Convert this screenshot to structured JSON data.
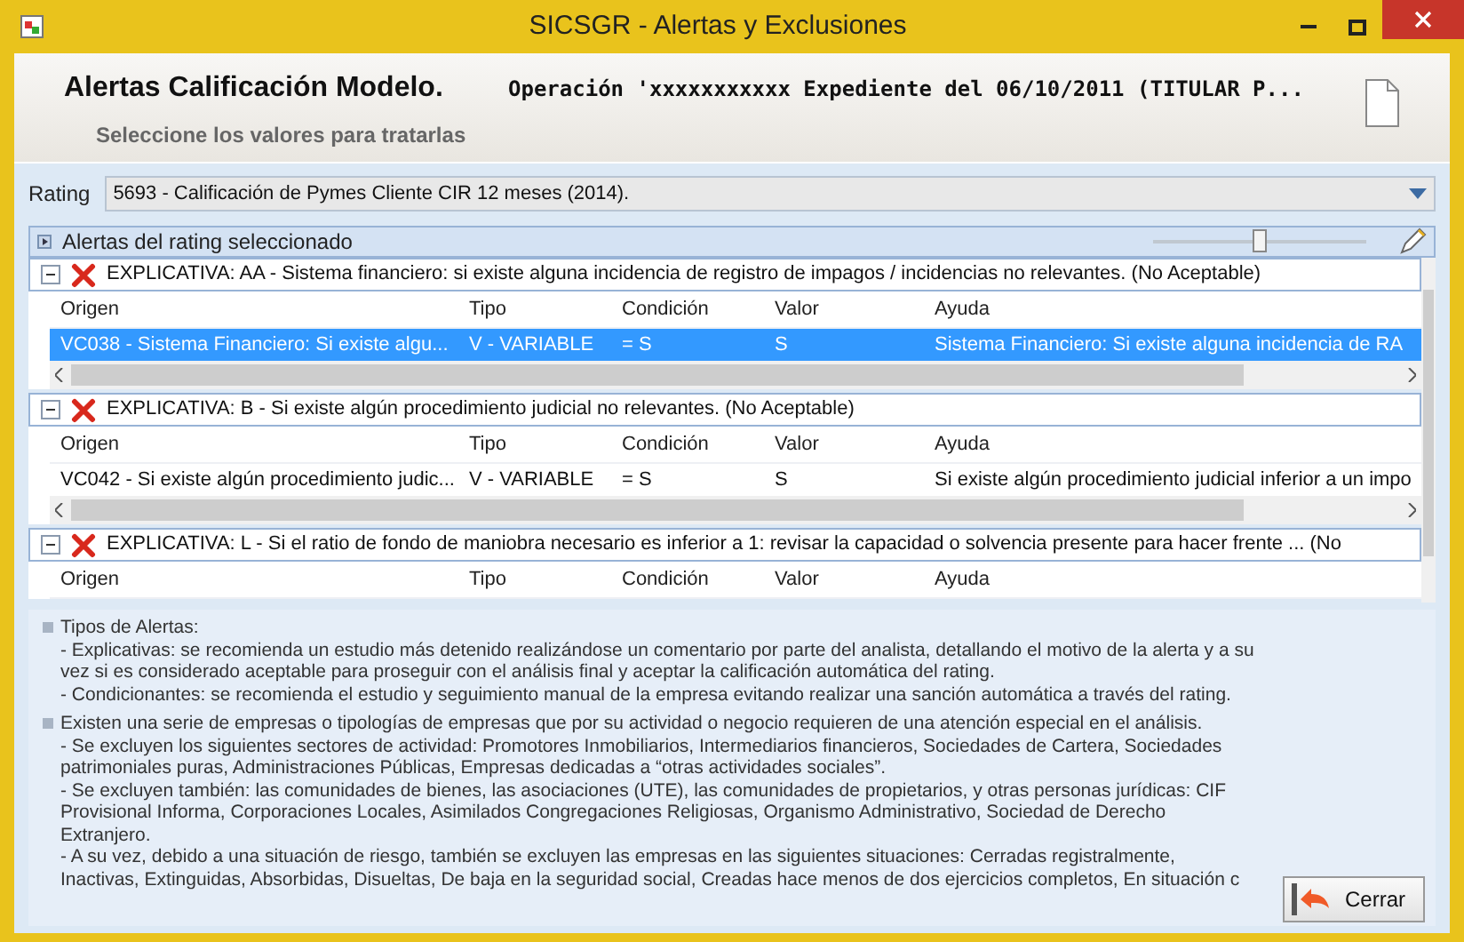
{
  "window": {
    "title": "SICSGR - Alertas y Exclusiones"
  },
  "header": {
    "title": "Alertas Calificación Modelo.",
    "subtitle": "Seleccione los valores para tratarlas",
    "operation": "Operación 'xxxxxxxxxxx Expediente del 06/10/2011 (TITULAR P..."
  },
  "rating": {
    "label": "Rating",
    "value": "5693 - Calificación de Pymes Cliente CIR 12 meses (2014)."
  },
  "alerts_panel": {
    "title": "Alertas del rating seleccionado",
    "expanded": false,
    "slider": {
      "level": 0.5
    }
  },
  "groups": [
    {
      "title": "EXPLICATIVA: AA - Sistema financiero: si existe alguna incidencia de registro de impagos / incidencias no relevantes. (No Aceptable)",
      "expanded": true,
      "columns": [
        "Origen",
        "Tipo",
        "Condición",
        "Valor",
        "Ayuda"
      ],
      "rows": [
        {
          "cells": [
            "VC038 - Sistema Financiero: Si existe algu...",
            "V - VARIABLE",
            "= S",
            "S",
            "Sistema Financiero: Si existe alguna incidencia de RA"
          ],
          "selected": true
        }
      ]
    },
    {
      "title": "EXPLICATIVA: B - Si existe algún procedimiento judicial no relevantes. (No Aceptable)",
      "expanded": true,
      "columns": [
        "Origen",
        "Tipo",
        "Condición",
        "Valor",
        "Ayuda"
      ],
      "rows": [
        {
          "cells": [
            "VC042 - Si existe algún procedimiento judic...",
            "V - VARIABLE",
            "= S",
            "S",
            "Si existe algún procedimiento judicial inferior a un impo"
          ],
          "selected": false
        }
      ]
    },
    {
      "title": "EXPLICATIVA: L - Si el ratio de fondo de maniobra necesario es inferior a 1: revisar la capacidad o solvencia presente para hacer frente ... (No",
      "expanded": true,
      "columns": [
        "Origen",
        "Tipo",
        "Condición",
        "Valor",
        "Ayuda"
      ]
    }
  ],
  "notes": [
    {
      "heading": "Tipos de Alertas:",
      "lines": [
        "- Explicativas: se recomienda un estudio más detenido realizándose un comentario por parte del analista, detallando el motivo de la alerta y a su vez si es considerado aceptable para proseguir con el análisis final y aceptar la calificación automática del rating.",
        "- Condicionantes: se recomienda el estudio y seguimiento manual de la empresa evitando realizar una sanción automática a través del rating."
      ]
    },
    {
      "heading": "Existen una serie de empresas o tipologías de empresas que por su actividad o negocio requieren de una atención especial en el análisis.",
      "lines": [
        "- Se excluyen los siguientes sectores de actividad: Promotores Inmobiliarios, Intermediarios financieros, Sociedades de Cartera, Sociedades patrimoniales puras, Administraciones Públicas, Empresas dedicadas a “otras actividades sociales”.",
        "- Se excluyen también: las comunidades de bienes, las asociaciones (UTE), las comunidades de propietarios, y otras personas jurídicas: CIF Provisional Informa, Corporaciones Locales, Asimilados Congregaciones Religiosas, Organismo Administrativo, Sociedad de Derecho Extranjero.",
        "- A su vez, debido a una situación de riesgo, también se excluyen las empresas en las siguientes situaciones: Cerradas registralmente, Inactivas, Extinguidas, Absorbidas, Disueltas, De baja en la seguridad social, Creadas hace menos de dos ejercicios completos, En situación c"
      ]
    }
  ],
  "close_button": {
    "label": "Cerrar"
  }
}
